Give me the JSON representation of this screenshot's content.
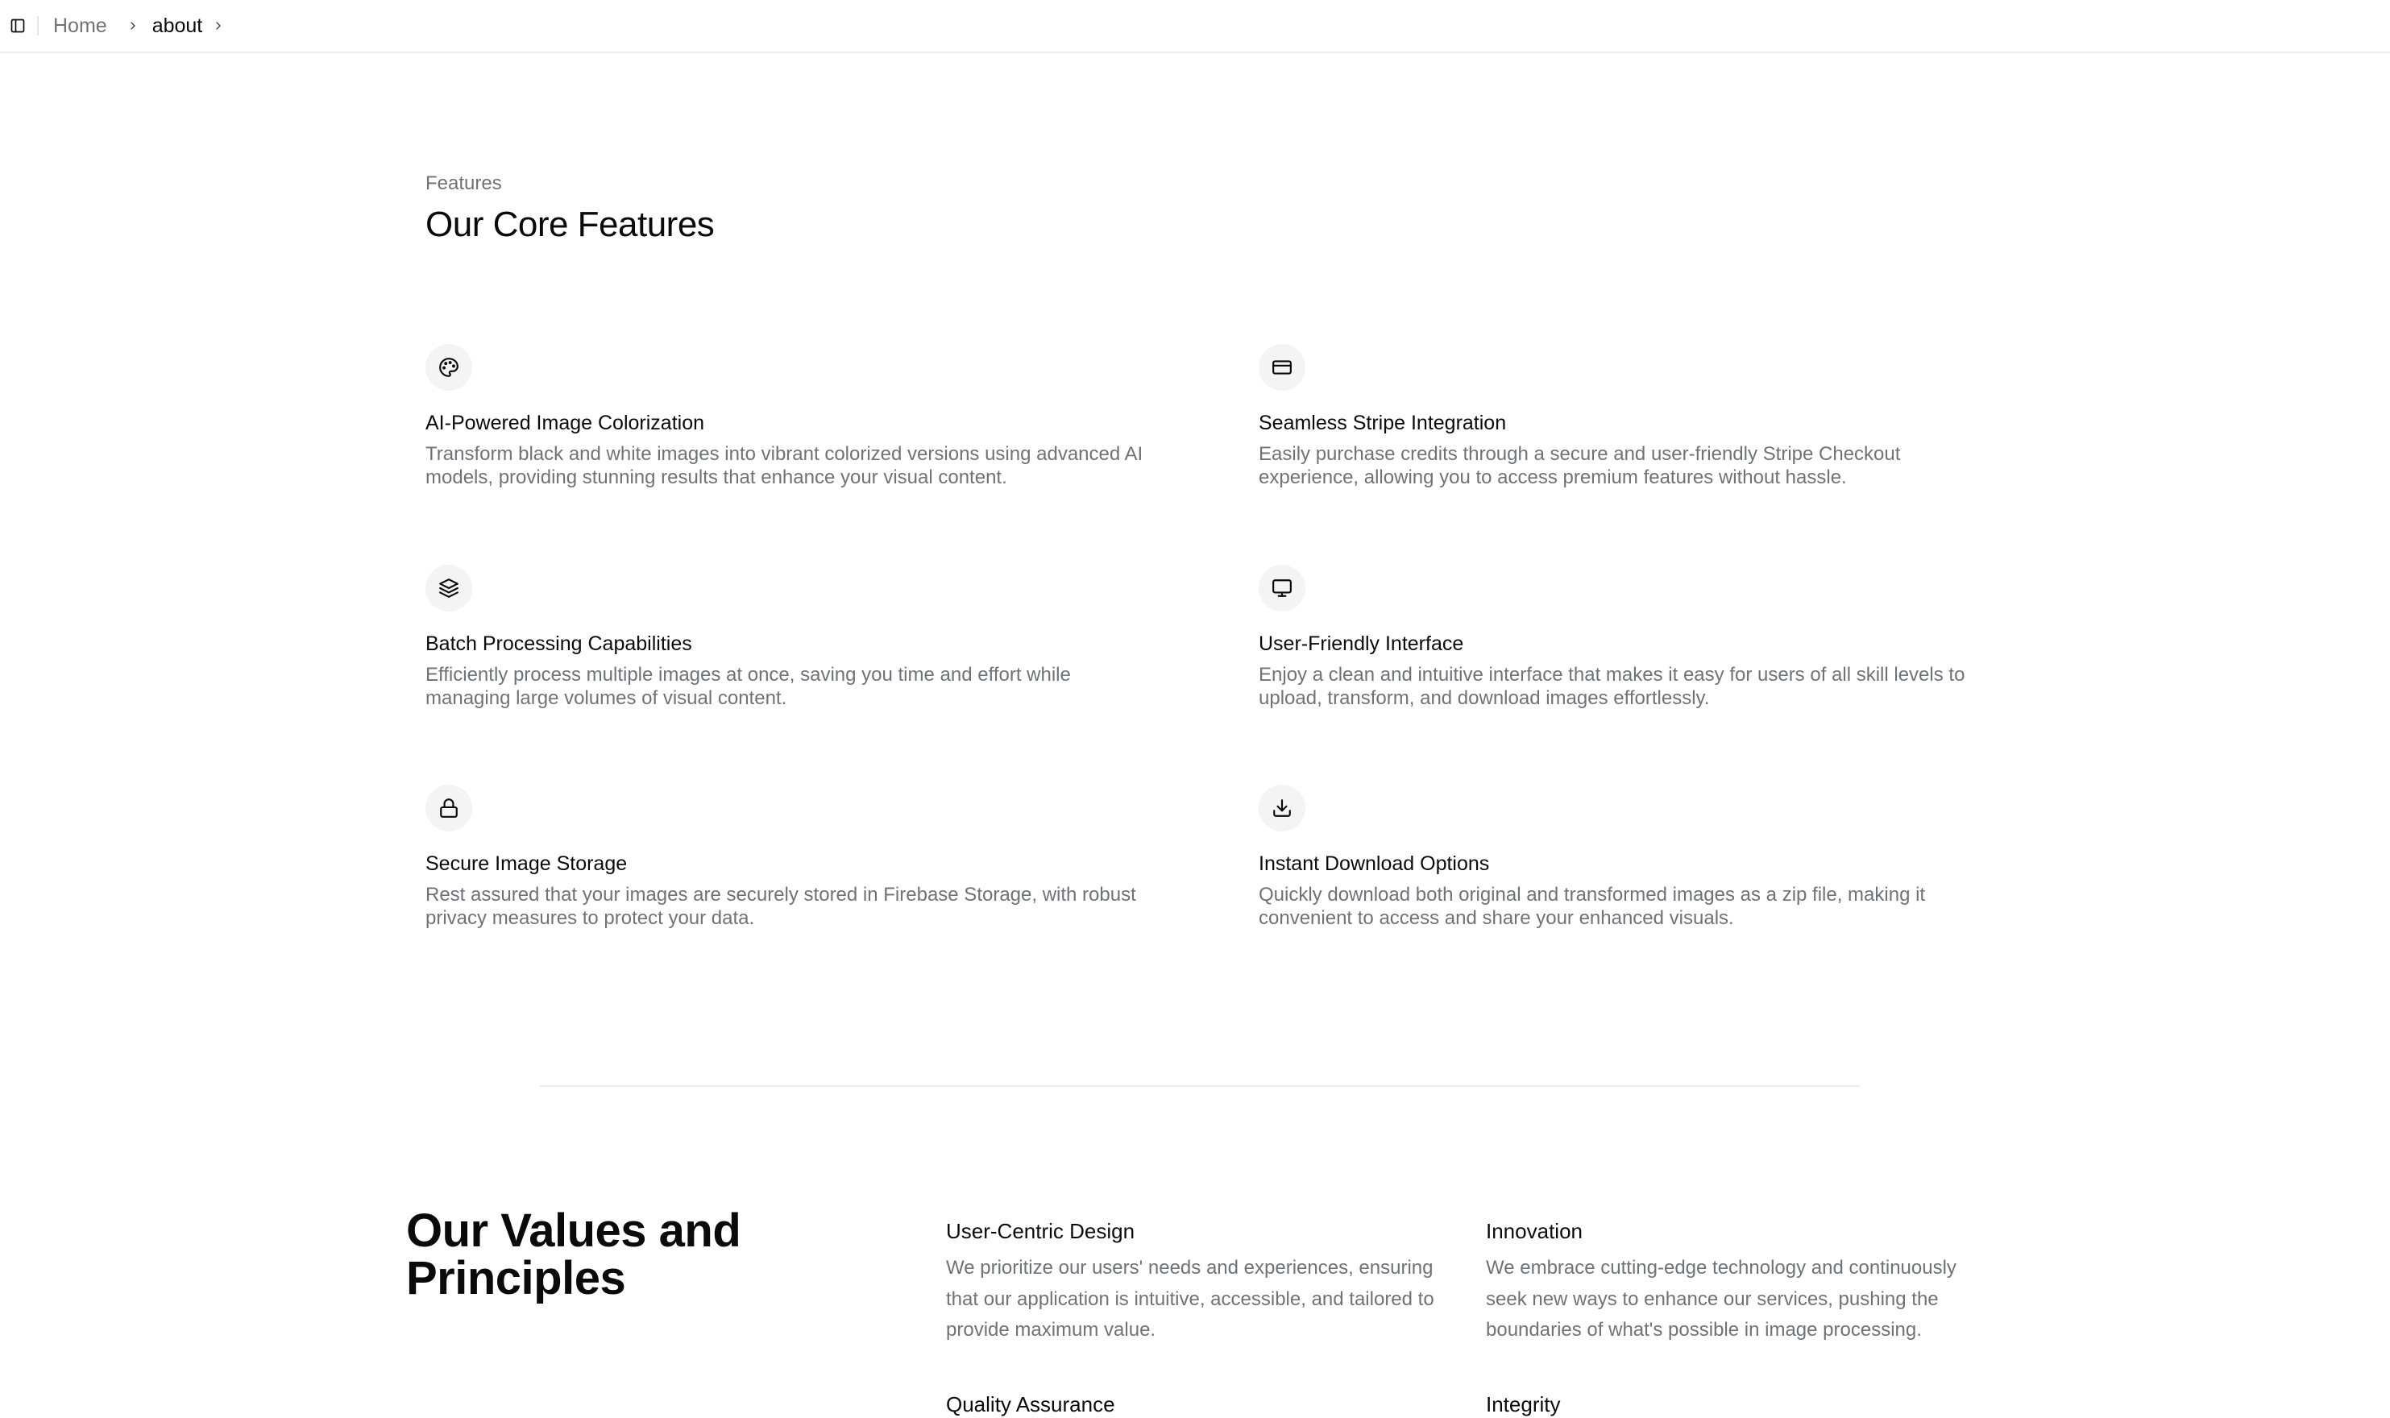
{
  "breadcrumb": {
    "home": "Home",
    "current": "about"
  },
  "features": {
    "eyebrow": "Features",
    "title": "Our Core Features",
    "items": [
      {
        "icon": "palette-icon",
        "title": "AI-Powered Image Colorization",
        "description": "Transform black and white images into vibrant colorized versions using advanced AI models, providing stunning results that enhance your visual content."
      },
      {
        "icon": "credit-card-icon",
        "title": "Seamless Stripe Integration",
        "description": "Easily purchase credits through a secure and user-friendly Stripe Checkout experience, allowing you to access premium features without hassle."
      },
      {
        "icon": "layers-icon",
        "title": "Batch Processing Capabilities",
        "description": "Efficiently process multiple images at once, saving you time and effort while managing large volumes of visual content."
      },
      {
        "icon": "monitor-icon",
        "title": "User-Friendly Interface",
        "description": "Enjoy a clean and intuitive interface that makes it easy for users of all skill levels to upload, transform, and download images effortlessly."
      },
      {
        "icon": "lock-icon",
        "title": "Secure Image Storage",
        "description": "Rest assured that your images are securely stored in Firebase Storage, with robust privacy measures to protect your data."
      },
      {
        "icon": "download-icon",
        "title": "Instant Download Options",
        "description": "Quickly download both original and transformed images as a zip file, making it convenient to access and share your enhanced visuals."
      }
    ]
  },
  "values": {
    "title": "Our Values and Principles",
    "items": [
      {
        "title": "User-Centric Design",
        "description": "We prioritize our users' needs and experiences, ensuring that our application is intuitive, accessible, and tailored to provide maximum value."
      },
      {
        "title": "Innovation",
        "description": "We embrace cutting-edge technology and continuously seek new ways to enhance our services, pushing the boundaries of what's possible in image processing."
      },
      {
        "title": "Quality Assurance",
        "description": ""
      },
      {
        "title": "Integrity",
        "description": ""
      }
    ]
  },
  "colors": {
    "text_primary": "#0a0a0a",
    "text_muted": "#71717a",
    "icon_bg": "#f4f4f5",
    "border": "#ececec"
  }
}
